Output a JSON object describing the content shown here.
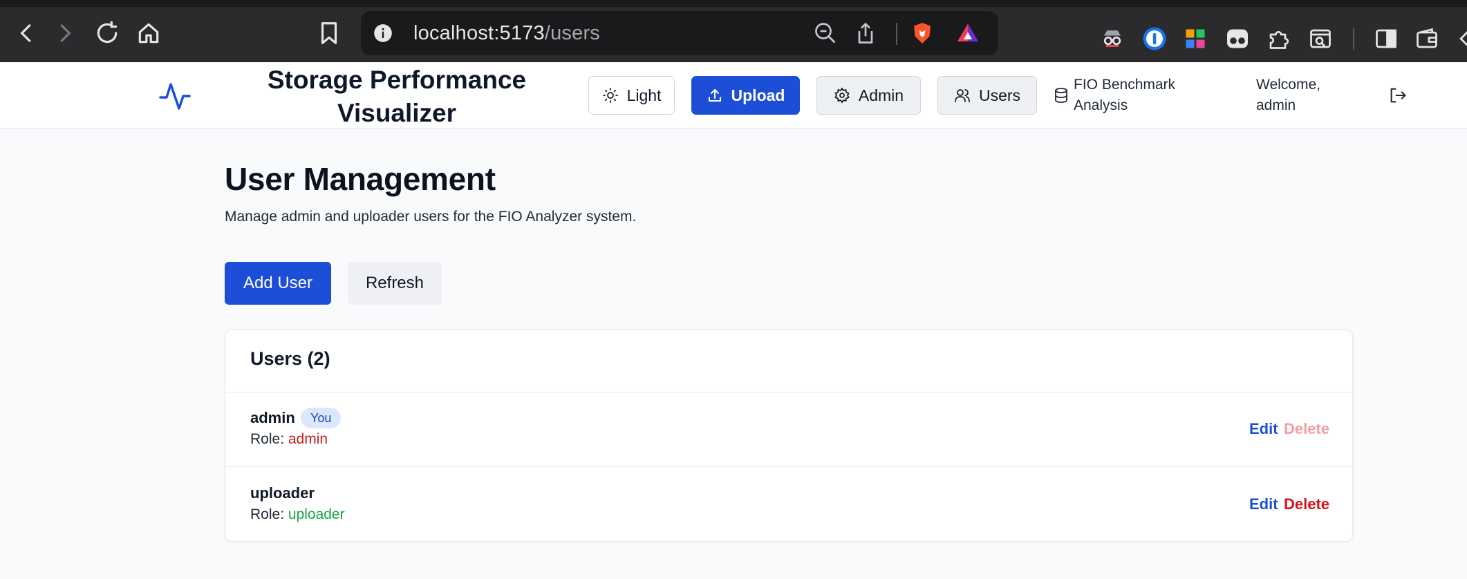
{
  "browser": {
    "url_host": "localhost:5173",
    "url_path": "/users"
  },
  "header": {
    "title": "Storage Performance Visualizer",
    "buttons": {
      "light": "Light",
      "upload": "Upload",
      "admin": "Admin",
      "users": "Users"
    },
    "app_subtitle": "FIO Benchmark Analysis",
    "welcome": "Welcome, admin"
  },
  "main": {
    "title": "User Management",
    "subtitle": "Manage admin and uploader users for the FIO Analyzer system.",
    "add_user_label": "Add User",
    "refresh_label": "Refresh",
    "users_card_title": "Users (2)",
    "role_prefix": "Role:",
    "edit_label": "Edit",
    "delete_label": "Delete",
    "you_badge": "You",
    "users": [
      {
        "username": "admin",
        "role": "admin",
        "is_current": true
      },
      {
        "username": "uploader",
        "role": "uploader",
        "is_current": false
      }
    ]
  },
  "colors": {
    "primary": "#1d4ed8",
    "role_admin": "#c81e1e",
    "role_uploader": "#16a34a",
    "delete": "#d4141a"
  }
}
